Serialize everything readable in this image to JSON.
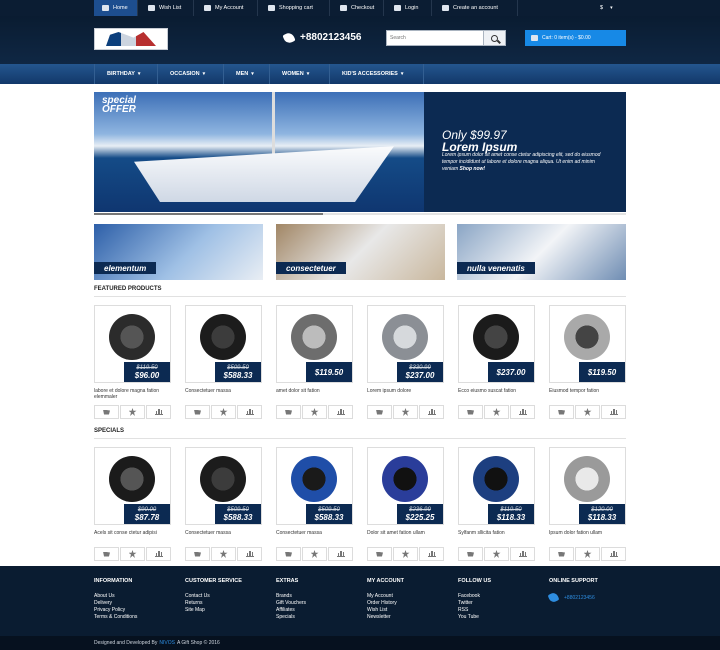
{
  "topbar": {
    "links": [
      {
        "label": "Home",
        "icon": "home-icon",
        "active": true
      },
      {
        "label": "Wish List",
        "icon": "star-icon"
      },
      {
        "label": "My Account",
        "icon": "user-icon"
      },
      {
        "label": "Shopping cart",
        "icon": "cart-icon"
      },
      {
        "label": "Checkout",
        "icon": "checkout-icon"
      },
      {
        "label": "Login",
        "icon": "key-icon"
      },
      {
        "label": "Create an account",
        "icon": "user-plus-icon"
      }
    ],
    "currency": "$"
  },
  "header": {
    "phone": "+8802123456",
    "search_placeholder": "Search",
    "cart_label": "Cart: 0 item(s) - $0.00"
  },
  "nav": {
    "items": [
      "BIRTHDAY",
      "OCCASION",
      "MEN",
      "WOMEN",
      "KID'S ACCESSORIES"
    ]
  },
  "banner": {
    "special": "special",
    "offer": "OFFER",
    "price": "Only $99.97",
    "title": "Lorem Ipsum",
    "text": "Lorem ipsum dolor sit amet conse ctetur adipiscing elit, sed do eiusmod tempor incididunt ut labore et dolore magna aliqua. Ut enim ad minim veniam",
    "shop": "Shop now!",
    "progress": 0.43
  },
  "promos": [
    {
      "label": "elementum"
    },
    {
      "label": "consectetuer"
    },
    {
      "label": "nulla venenatis"
    }
  ],
  "featured": {
    "title": "FEATURED PRODUCTS",
    "products": [
      {
        "name": "labore et dolore magna fation elemmaler",
        "old": "$119.50",
        "price": "$96.00"
      },
      {
        "name": "Consectetuer massa",
        "old": "$509.50",
        "price": "$588.33"
      },
      {
        "name": "amet dolor sit fation",
        "old": "",
        "price": "$119.50"
      },
      {
        "name": "Lorem ipsum dolore",
        "old": "$330.99",
        "price": "$237.00"
      },
      {
        "name": "Ecco eiusmo suscat fation",
        "old": "",
        "price": "$237.00"
      },
      {
        "name": "Eiusmod tempor fation",
        "old": "",
        "price": "$119.50"
      }
    ]
  },
  "specials": {
    "title": "SPECIALS",
    "products": [
      {
        "name": "Acels sit conse ctetur adipisi",
        "old": "$90.00",
        "price": "$87.78"
      },
      {
        "name": "Consectetuer massa",
        "old": "$509.50",
        "price": "$588.33"
      },
      {
        "name": "Consectetuer massa",
        "old": "$509.50",
        "price": "$588.33"
      },
      {
        "name": "Dolor sit amet fation ullam",
        "old": "$236.99",
        "price": "$225.25"
      },
      {
        "name": "Sylfanm sllicita fation",
        "old": "$119.50",
        "price": "$118.33"
      },
      {
        "name": "Ipsum dolor fation ullam",
        "old": "$120.00",
        "price": "$118.33"
      }
    ]
  },
  "footer": {
    "columns": [
      {
        "title": "INFORMATION",
        "links": [
          "About Us",
          "Delivery",
          "Privacy Policy",
          "Terms & Conditions"
        ]
      },
      {
        "title": "CUSTOMER SERVICE",
        "links": [
          "Contact Us",
          "Returns",
          "Site Map"
        ]
      },
      {
        "title": "EXTRAS",
        "links": [
          "Brands",
          "Gift Vouchers",
          "Affiliates",
          "Specials"
        ]
      },
      {
        "title": "MY ACCOUNT",
        "links": [
          "My Account",
          "Order History",
          "Wish List",
          "Newsletter"
        ]
      },
      {
        "title": "FOLLOW US",
        "links": [
          "Facebook",
          "Twitter",
          "RSS",
          "You Tube"
        ]
      },
      {
        "title": "ONLINE SUPPORT",
        "links": []
      }
    ],
    "support_phone": "+8802123456",
    "bottom_prefix": "Designed and Developed By",
    "bottom_brand": "NIVOS",
    "bottom_suffix": "A Gift Shop © 2016"
  }
}
